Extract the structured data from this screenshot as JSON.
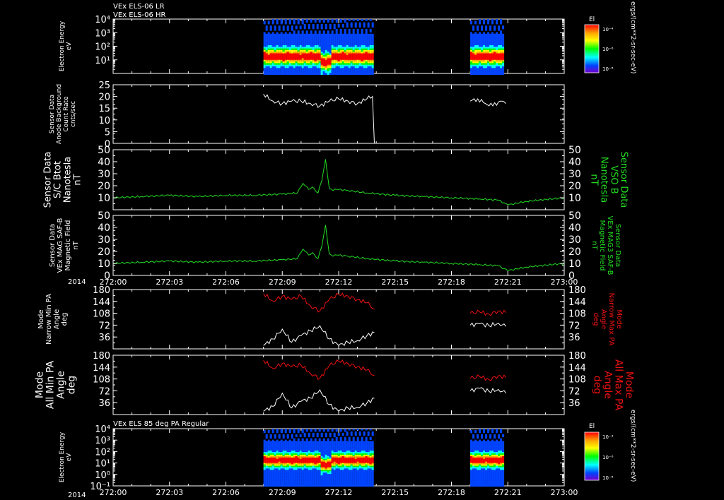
{
  "header": {
    "line1": "VEx ELS-06 LR",
    "line2": "VEx ELS-06 HR",
    "panel7_title": "VEx ELS 85 deg PA Regular"
  },
  "colors": {
    "background": "#000000",
    "axis": "#ffffff",
    "green": "#22dd22",
    "red": "#ee1111",
    "white": "#ffffff"
  },
  "colorbar": {
    "label": "El",
    "ticks": [
      "10⁻⁴",
      "10⁻⁶",
      "10⁻⁸"
    ],
    "unit": "ergs/(cm**2-sr-sec-eV)"
  },
  "time_axis": {
    "year": "2014",
    "ticks": [
      "272:00",
      "272:03",
      "272:06",
      "272:09",
      "272:12",
      "272:15",
      "272:18",
      "272:21",
      "273:00"
    ]
  },
  "chart_data": [
    {
      "type": "heatmap",
      "title": "VEx ELS-06 LR / VEx ELS-06 HR",
      "ylabel": [
        "Electron Energy",
        "eV"
      ],
      "yscale": "log",
      "ylim": [
        1,
        10000
      ],
      "yticks": [
        "10⁴",
        "10³",
        "10²",
        "10¹"
      ],
      "x_segments": [
        [
          "272:08.0",
          "272:13.9"
        ],
        [
          "272:19.0",
          "272:20.9"
        ]
      ],
      "color_scale": "El"
    },
    {
      "type": "line",
      "ylabel": [
        "Sensor Data",
        "Anode Background",
        "Count Rate",
        "cnts/sec"
      ],
      "ylim": [
        0,
        25
      ],
      "yticks": [
        "25",
        "20",
        "15",
        "10",
        "5",
        "0"
      ],
      "series": [
        {
          "color": "white",
          "x": [
            "272:08.0",
            "272:08.5",
            "272:09.0",
            "272:09.5",
            "272:10.0",
            "272:10.5",
            "272:11.0",
            "272:11.5",
            "272:12.0",
            "272:12.5",
            "272:13.0",
            "272:13.5",
            "272:13.8",
            "272:13.9"
          ],
          "values": [
            21,
            18,
            17,
            18,
            18,
            17,
            16,
            18,
            19,
            18,
            17,
            19,
            20,
            0
          ]
        },
        {
          "color": "white",
          "x": [
            "272:19.0",
            "272:19.4",
            "272:19.8",
            "272:20.2",
            "272:20.6",
            "272:20.9"
          ],
          "values": [
            18,
            19,
            17,
            16,
            18,
            17
          ]
        }
      ]
    },
    {
      "type": "line",
      "ylabel": [
        "Sensor Data",
        "S/C Btot",
        "Nanotesla",
        "nT"
      ],
      "ylabel_right": [
        "Sensor Data",
        "VSO B",
        "Nanotesla",
        "nT"
      ],
      "ylim": [
        0,
        50
      ],
      "yticks": [
        "50",
        "40",
        "30",
        "20",
        "10"
      ],
      "series": [
        {
          "color": "green",
          "x": [
            "272:00.0",
            "272:01.5",
            "272:03.0",
            "272:04.5",
            "272:06.0",
            "272:07.5",
            "272:09.0",
            "272:09.8",
            "272:10.1",
            "272:10.4",
            "272:10.6",
            "272:10.9",
            "272:11.1",
            "272:11.3",
            "272:11.5",
            "272:11.7",
            "272:11.9",
            "272:12.5",
            "272:13.5",
            "272:15.0",
            "272:16.5",
            "272:18.0",
            "272:19.5",
            "272:20.5",
            "272:21.0",
            "272:22.0",
            "272:24.0"
          ],
          "values": [
            10,
            11,
            12,
            11,
            12,
            12,
            13,
            14,
            22,
            17,
            19,
            14,
            24,
            42,
            18,
            16,
            17,
            16,
            14,
            12,
            11,
            10,
            9,
            8,
            4,
            7,
            10
          ]
        }
      ]
    },
    {
      "type": "line",
      "ylabel": [
        "Sensor Data",
        "VEx MAG SAF-B",
        "Magnetic Field",
        "nT"
      ],
      "ylabel_right": [
        "Sensor Data",
        "VEx MAG3 SAF-B",
        "Magnetic Field",
        "nT"
      ],
      "ylim": [
        0,
        50
      ],
      "yticks": [
        "50",
        "40",
        "30",
        "20",
        "10",
        "0"
      ],
      "series": [
        {
          "color": "green",
          "x": [
            "272:00.0",
            "272:01.5",
            "272:03.0",
            "272:04.5",
            "272:06.0",
            "272:07.5",
            "272:09.0",
            "272:09.8",
            "272:10.1",
            "272:10.4",
            "272:10.6",
            "272:10.9",
            "272:11.1",
            "272:11.3",
            "272:11.5",
            "272:11.7",
            "272:11.9",
            "272:12.5",
            "272:13.5",
            "272:15.0",
            "272:16.5",
            "272:18.0",
            "272:19.5",
            "272:20.5",
            "272:21.0",
            "272:22.0",
            "272:24.0"
          ],
          "values": [
            10,
            11,
            12,
            11,
            12,
            12,
            13,
            14,
            22,
            17,
            19,
            14,
            24,
            42,
            18,
            16,
            17,
            16,
            14,
            12,
            11,
            10,
            9,
            8,
            4,
            7,
            10
          ]
        }
      ]
    },
    {
      "type": "line",
      "ylabel": [
        "Mode",
        "Narrow Min PA",
        "Angle",
        "deg"
      ],
      "ylabel_right": [
        "Mode",
        "Narrow Max PA",
        "Angle",
        "deg"
      ],
      "ylim": [
        0,
        180
      ],
      "yticks": [
        "180",
        "144",
        "108",
        "72",
        "36"
      ],
      "series": [
        {
          "color": "red",
          "x": [
            "272:08.0",
            "272:08.5",
            "272:09.0",
            "272:09.5",
            "272:10.0",
            "272:10.5",
            "272:11.0",
            "272:11.5",
            "272:12.0",
            "272:12.5",
            "272:13.0",
            "272:13.5",
            "272:13.9"
          ],
          "values": [
            168,
            145,
            160,
            150,
            160,
            130,
            115,
            150,
            165,
            160,
            150,
            140,
            120
          ]
        },
        {
          "color": "white",
          "x": [
            "272:08.0",
            "272:08.5",
            "272:09.0",
            "272:09.5",
            "272:10.0",
            "272:10.5",
            "272:11.0",
            "272:11.5",
            "272:12.0",
            "272:12.5",
            "272:13.0",
            "272:13.5",
            "272:13.9"
          ],
          "values": [
            10,
            30,
            60,
            20,
            40,
            55,
            70,
            30,
            10,
            20,
            25,
            40,
            50
          ]
        },
        {
          "color": "red",
          "x": [
            "272:19.0",
            "272:19.5",
            "272:20.0",
            "272:20.5",
            "272:20.9"
          ],
          "values": [
            108,
            112,
            105,
            115,
            110
          ]
        },
        {
          "color": "white",
          "x": [
            "272:19.0",
            "272:19.5",
            "272:20.0",
            "272:20.5",
            "272:20.9"
          ],
          "values": [
            72,
            76,
            70,
            78,
            68
          ]
        }
      ]
    },
    {
      "type": "line",
      "ylabel": [
        "Mode",
        "All Min PA",
        "Angle",
        "deg"
      ],
      "ylabel_right": [
        "Mode",
        "All Max PA",
        "Angle",
        "deg"
      ],
      "ylim": [
        0,
        180
      ],
      "yticks": [
        "180",
        "144",
        "108",
        "72",
        "36"
      ],
      "series": [
        {
          "color": "red",
          "x": [
            "272:08.0",
            "272:08.5",
            "272:09.0",
            "272:09.5",
            "272:10.0",
            "272:10.5",
            "272:11.0",
            "272:11.5",
            "272:12.0",
            "272:12.5",
            "272:13.0",
            "272:13.5",
            "272:13.9"
          ],
          "values": [
            165,
            140,
            155,
            145,
            150,
            125,
            110,
            148,
            162,
            155,
            145,
            135,
            118
          ]
        },
        {
          "color": "white",
          "x": [
            "272:08.0",
            "272:08.5",
            "272:09.0",
            "272:09.5",
            "272:10.0",
            "272:10.5",
            "272:11.0",
            "272:11.5",
            "272:12.0",
            "272:12.5",
            "272:13.0",
            "272:13.5",
            "272:13.9"
          ],
          "values": [
            10,
            25,
            65,
            20,
            40,
            50,
            75,
            30,
            10,
            20,
            22,
            35,
            50
          ]
        },
        {
          "color": "red",
          "x": [
            "272:19.0",
            "272:19.5",
            "272:20.0",
            "272:20.5",
            "272:20.9"
          ],
          "values": [
            110,
            115,
            106,
            118,
            112
          ]
        },
        {
          "color": "white",
          "x": [
            "272:19.0",
            "272:19.5",
            "272:20.0",
            "272:20.5",
            "272:20.9"
          ],
          "values": [
            72,
            80,
            70,
            76,
            65
          ]
        }
      ]
    },
    {
      "type": "heatmap",
      "title": "VEx ELS 85 deg PA Regular",
      "ylabel": [
        "Electron Energy",
        "eV"
      ],
      "yscale": "log",
      "ylim": [
        0.1,
        10000
      ],
      "yticks": [
        "10⁴",
        "10³",
        "10²",
        "10¹",
        "10⁰",
        "10⁻¹"
      ],
      "x_segments": [
        [
          "272:08.0",
          "272:13.9"
        ],
        [
          "272:19.0",
          "272:20.9"
        ]
      ],
      "color_scale": "El"
    }
  ]
}
